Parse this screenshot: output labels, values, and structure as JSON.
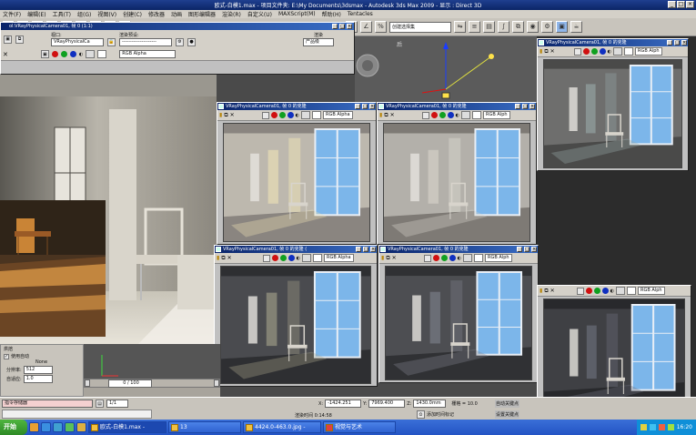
{
  "app_title": "欧式-白模1.max    - 项目文件夹: E:\\My Documents\\3dsmax    - Autodesk 3ds Max  2009    - 显示 : Direct 3D",
  "menu": [
    "文件(F)",
    "编辑(E)",
    "工具(T)",
    "组(G)",
    "视图(V)",
    "创建(C)",
    "修改器",
    "动画",
    "图形编辑器",
    "渲染(R)",
    "自定义(U)",
    "MAXScript(M)",
    "帮助(H)",
    "Tentacles"
  ],
  "render_dialog": {
    "title": "ol:VRayPhysicalCamera01, 帧 0 (1:1)",
    "viewport_label": "视口:",
    "viewport_value": "VRayPhysicalCa",
    "preset_label": "渲染预设:",
    "preset_value": "---------------------",
    "render_button": "渲染",
    "product_value": "产品级",
    "channel_value": "RGB Alpha"
  },
  "frame_windows": [
    {
      "title": "VRayPhysicalCamera01, 帧 0 的克隆",
      "channel": "RGB Alpha"
    },
    {
      "title": "VRayPhysicalCamera01, 帧 0 的克隆",
      "channel": "RGB Alph"
    },
    {
      "title": "VRayPhysicalCamera01, 帧 0 的克隆",
      "channel": "RGB Alph"
    },
    {
      "title": "VRayPhysicalCamera01, 帧 0 的克隆 (",
      "channel": "RGB Alpha"
    },
    {
      "title": "VRayPhysicalCamera01, 帧 0 的克隆",
      "channel": "RGB Alph"
    },
    {
      "title": "",
      "channel": "RGB Alph"
    }
  ],
  "viewport_label_right": "后",
  "left_panel": {
    "section": "烘焙",
    "use_autosize": "使用自动",
    "mode": "None",
    "res_label": "分辨率:",
    "res_value": "512",
    "spacing_label": "自适应:",
    "spacing_value": "1.0"
  },
  "timeline": {
    "frame_value": "0 / 100"
  },
  "status": {
    "x_label": "X:",
    "x_value": "-1424.251",
    "y_label": "Y:",
    "y_value": "7969.400",
    "z_label": "Z:",
    "z_value": "1430.0mm",
    "grid": "栅格 = 10.0",
    "auto_key": "自动关键点",
    "set_key": "设置关键点",
    "add_time_tag": "添加时间标记",
    "render_time": "渲染时间  0:14:58",
    "prompt": "指令存储器"
  },
  "taskbar": {
    "start": "开始",
    "tasks": [
      "欧式-白模1.max -",
      "13",
      "4424.0-463.0.jpg -",
      "视觉与艺术"
    ],
    "clock": "16:20",
    "script_tab": "1/1"
  },
  "colors": {
    "red": "#d01010",
    "green": "#10a020",
    "blue": "#1030c0"
  }
}
